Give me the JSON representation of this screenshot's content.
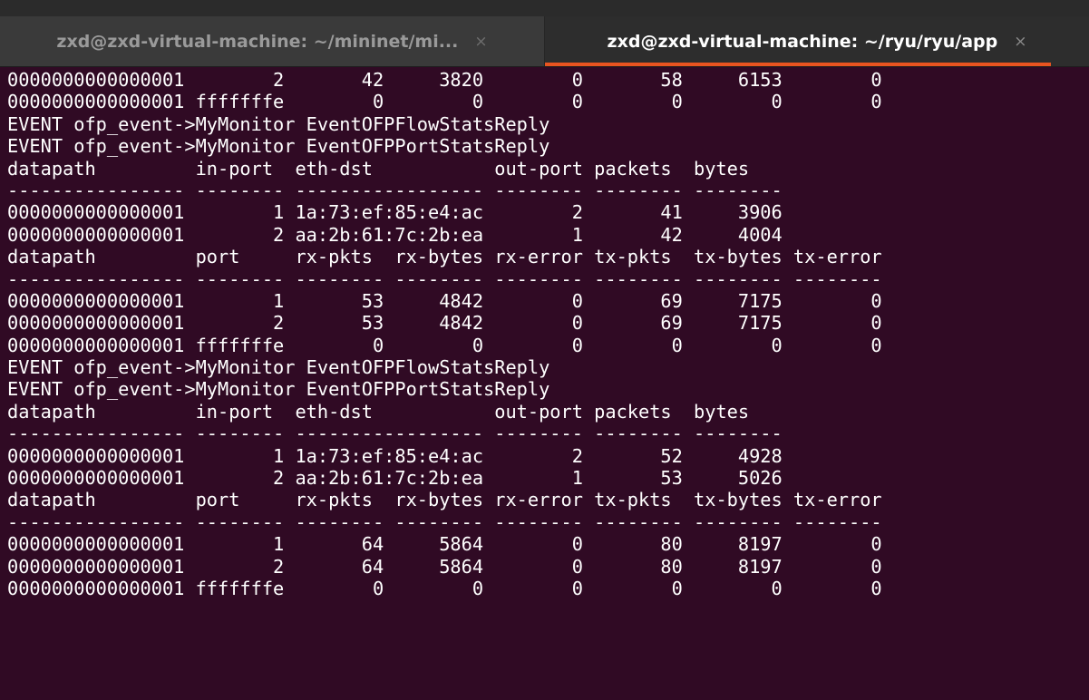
{
  "tabs": [
    {
      "title": "zxd@zxd-virtual-machine: ~/mininet/mi...",
      "close": "×",
      "active": false
    },
    {
      "title": "zxd@zxd-virtual-machine: ~/ryu/ryu/app",
      "close": "×",
      "active": true
    }
  ],
  "terminal": {
    "lines": [
      "0000000000000001        2       42     3820        0       58     6153        0",
      "0000000000000001 fffffffe        0        0        0        0        0        0",
      "EVENT ofp_event->MyMonitor EventOFPFlowStatsReply",
      "EVENT ofp_event->MyMonitor EventOFPPortStatsReply",
      "datapath         in-port  eth-dst           out-port packets  bytes",
      "---------------- -------- ----------------- -------- -------- --------",
      "0000000000000001        1 1a:73:ef:85:e4:ac        2       41     3906",
      "0000000000000001        2 aa:2b:61:7c:2b:ea        1       42     4004",
      "datapath         port     rx-pkts  rx-bytes rx-error tx-pkts  tx-bytes tx-error",
      "---------------- -------- -------- -------- -------- -------- -------- --------",
      "0000000000000001        1       53     4842        0       69     7175        0",
      "0000000000000001        2       53     4842        0       69     7175        0",
      "0000000000000001 fffffffe        0        0        0        0        0        0",
      "EVENT ofp_event->MyMonitor EventOFPFlowStatsReply",
      "EVENT ofp_event->MyMonitor EventOFPPortStatsReply",
      "datapath         in-port  eth-dst           out-port packets  bytes",
      "---------------- -------- ----------------- -------- -------- --------",
      "0000000000000001        1 1a:73:ef:85:e4:ac        2       52     4928",
      "0000000000000001        2 aa:2b:61:7c:2b:ea        1       53     5026",
      "datapath         port     rx-pkts  rx-bytes rx-error tx-pkts  tx-bytes tx-error",
      "---------------- -------- -------- -------- -------- -------- -------- --------",
      "0000000000000001        1       64     5864        0       80     8197        0",
      "0000000000000001        2       64     5864        0       80     8197        0",
      "0000000000000001 fffffffe        0        0        0        0        0        0"
    ]
  },
  "colors": {
    "terminal_bg": "#300a24",
    "text": "#ffffff",
    "tab_accent": "#e95420"
  }
}
